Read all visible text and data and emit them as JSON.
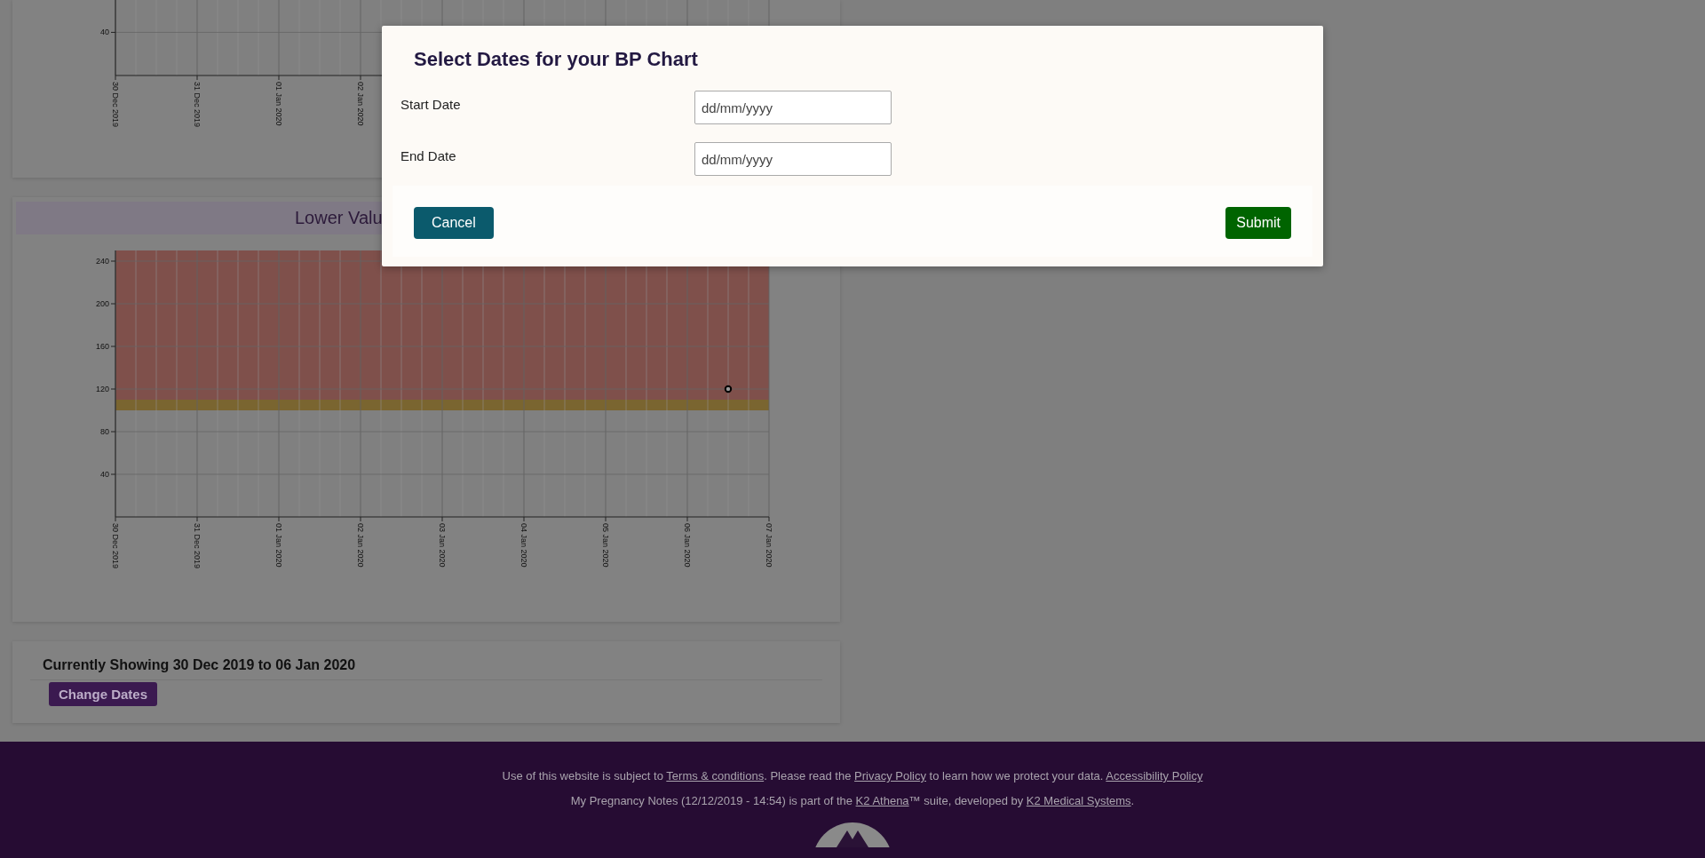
{
  "upper_chart": {
    "chart_data": {
      "type": "other",
      "categories": [
        "30 Dec 2019",
        null,
        null,
        null,
        "31 Dec 2019",
        null,
        null,
        null,
        "01 Jan 2020",
        null,
        null,
        null,
        "02 Jan 2020",
        null,
        null,
        null,
        null,
        null,
        null,
        null,
        null,
        null,
        null,
        null,
        null,
        null,
        null,
        null,
        null,
        null,
        null,
        null,
        null
      ],
      "annotations": [
        {
          "text": "40"
        }
      ]
    }
  },
  "lower_chart": {
    "title": "Lower Valu",
    "chart_data": {
      "type": "scatter",
      "grid": true,
      "ylim": [
        0,
        250
      ],
      "yticks": [
        40,
        80,
        120,
        160,
        200,
        240
      ],
      "categories": [
        "30 Dec 2019",
        null,
        null,
        null,
        "31 Dec 2019",
        null,
        null,
        null,
        "01 Jan 2020",
        null,
        null,
        null,
        "02 Jan 2020",
        null,
        null,
        null,
        "03 Jan 2020",
        null,
        null,
        null,
        "04 Jan 2020",
        null,
        null,
        null,
        "05 Jan 2020",
        null,
        null,
        null,
        "06 Jan 2020",
        null,
        null,
        null,
        "07 Jan 2020"
      ],
      "series": [
        {
          "color": "#000000",
          "values": [
            null,
            null,
            null,
            null,
            null,
            null,
            null,
            null,
            null,
            null,
            null,
            null,
            null,
            null,
            null,
            null,
            null,
            null,
            null,
            null,
            null,
            null,
            null,
            null,
            null,
            null,
            null,
            null,
            null,
            null,
            120,
            null,
            null
          ]
        }
      ],
      "bands": [
        {
          "axis": "y",
          "from": 110,
          "to": 250,
          "color": "#7f504b"
        },
        {
          "axis": "y",
          "from": 100,
          "to": 110,
          "color": "#7a6530"
        }
      ]
    }
  },
  "date_range": {
    "text": "Currently Showing 30 Dec 2019 to 06 Jan 2020",
    "button": "Change Dates"
  },
  "footer": {
    "lines": [
      [
        {
          "kind": "text",
          "text": "Use of this website is subject to "
        },
        {
          "kind": "link",
          "text": "Terms & conditions"
        },
        {
          "kind": "text",
          "text": ". Please read the "
        },
        {
          "kind": "link",
          "text": "Privacy Policy"
        },
        {
          "kind": "text",
          "text": " to learn how we protect your data. "
        },
        {
          "kind": "link",
          "text": "Accessibility Policy"
        }
      ],
      [
        {
          "kind": "text",
          "text": "My Pregnancy Notes (12/12/2019 - 14:54) is part of the "
        },
        {
          "kind": "link",
          "text": "K2 Athena"
        },
        {
          "kind": "text",
          "text": "™ suite, developed by "
        },
        {
          "kind": "link",
          "text": "K2 Medical Systems"
        },
        {
          "kind": "text",
          "text": "."
        }
      ]
    ]
  },
  "dialog": {
    "title": "Select Dates for your BP Chart",
    "fields": [
      {
        "label": "Start Date",
        "placeholder": "dd/mm/yyyy"
      },
      {
        "label": "End Date",
        "placeholder": "dd/mm/yyyy"
      }
    ],
    "buttons": [
      {
        "kind": "cancel",
        "label": "Cancel"
      },
      {
        "kind": "submit",
        "label": "Submit"
      }
    ]
  }
}
